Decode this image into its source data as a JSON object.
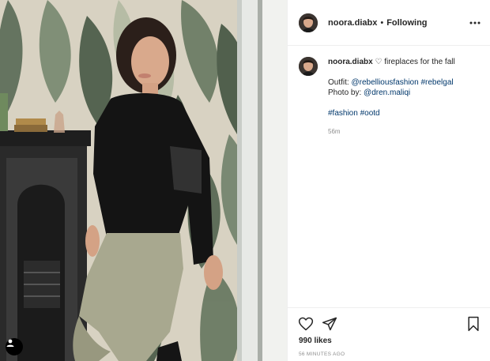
{
  "post": {
    "username": "noora.diabx",
    "separator": "•",
    "follow_status": "Following",
    "caption_text": "fireplaces for the fall",
    "caption_heart": "♡",
    "outfit_label": "Outfit:",
    "outfit_mention": "@rebelliousfashion",
    "outfit_tag": "#rebelgal",
    "photo_label": "Photo by:",
    "photo_mention": "@dren.maliqi",
    "hashtag_1": "#fashion",
    "hashtag_2": "#ootd",
    "caption_time": "56m",
    "likes": "990 likes",
    "posted_time": "56 MINUTES AGO"
  },
  "icons": {
    "more": "more-horizontal-icon",
    "like": "heart-icon",
    "share": "paper-plane-icon",
    "save": "bookmark-icon",
    "user_tag": "user-tag-icon"
  },
  "colors": {
    "link": "#00376b",
    "text": "#262626",
    "muted": "#8e8e8e",
    "border": "#efefef"
  }
}
